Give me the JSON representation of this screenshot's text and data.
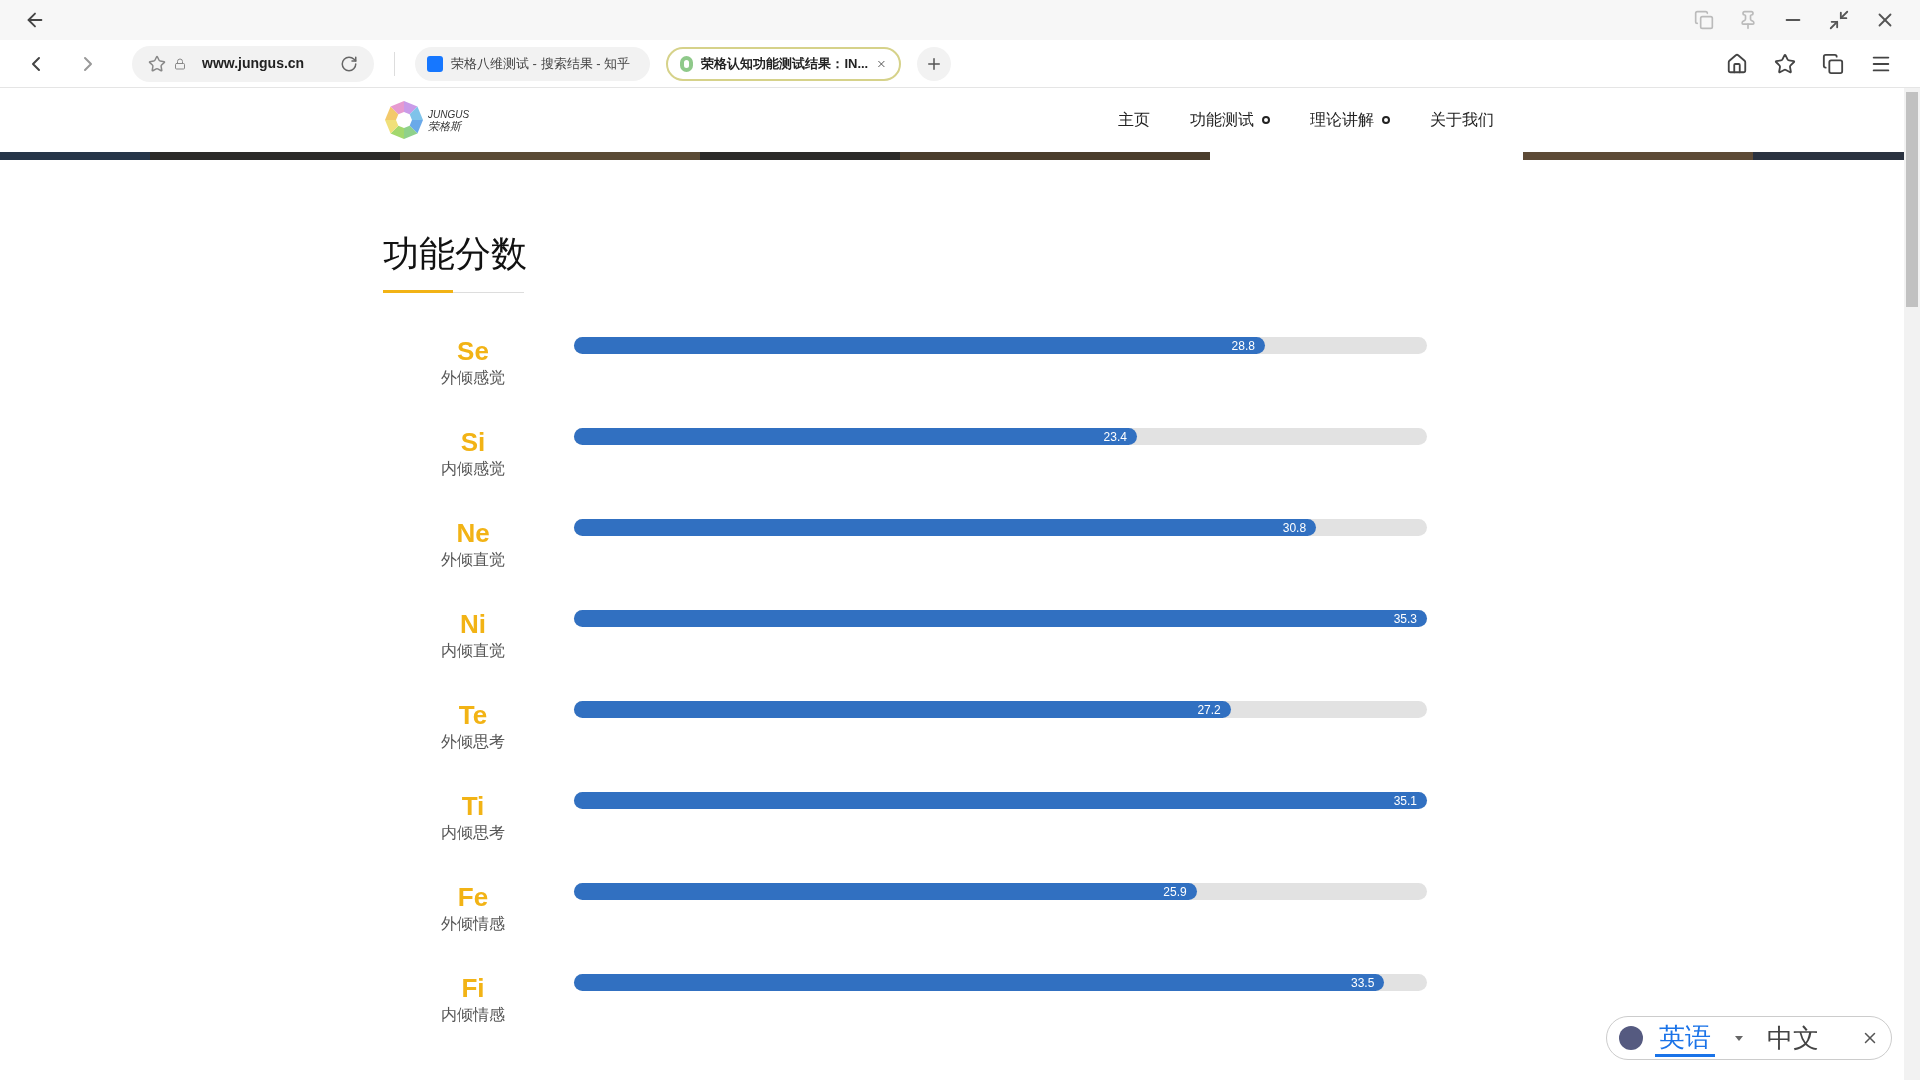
{
  "browser": {
    "url": "www.jungus.cn",
    "tabs": [
      {
        "title": "荣格八维测试 - 搜索结果 - 知乎",
        "selected": false,
        "kind": "zhihu"
      },
      {
        "title": "荣格认知功能测试结果：IN...",
        "selected": true,
        "kind": "site"
      }
    ]
  },
  "nav": {
    "logo_en": "JUNGUS",
    "logo_cn": "荣格斯",
    "items": [
      {
        "label": "主页",
        "dropdown": false
      },
      {
        "label": "功能测试",
        "dropdown": true
      },
      {
        "label": "理论讲解",
        "dropdown": true
      },
      {
        "label": "关于我们",
        "dropdown": false
      }
    ]
  },
  "section": {
    "title": "功能分数"
  },
  "scores": [
    {
      "code": "Se",
      "name": "外倾感觉",
      "value": "28.8",
      "level": 0.81
    },
    {
      "code": "Si",
      "name": "内倾感觉",
      "value": "23.4",
      "level": 0.66
    },
    {
      "code": "Ne",
      "name": "外倾直觉",
      "value": "30.8",
      "level": 0.87
    },
    {
      "code": "Ni",
      "name": "内倾直觉",
      "value": "35.3",
      "level": 1.0
    },
    {
      "code": "Te",
      "name": "外倾思考",
      "value": "27.2",
      "level": 0.77
    },
    {
      "code": "Ti",
      "name": "内倾思考",
      "value": "35.1",
      "level": 1.0
    },
    {
      "code": "Fe",
      "name": "外倾情感",
      "value": "25.9",
      "level": 0.73
    },
    {
      "code": "Fi",
      "name": "内倾情感",
      "value": "33.5",
      "level": 0.95
    }
  ],
  "translate": {
    "languages": [
      {
        "label": "英语",
        "selected": true
      },
      {
        "label": "中文",
        "selected": false
      }
    ]
  }
}
